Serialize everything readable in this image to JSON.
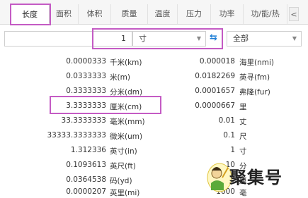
{
  "tabs": [
    "长度",
    "面积",
    "体积",
    "质量",
    "温度",
    "压力",
    "功率",
    "功/能/热"
  ],
  "tab_scroll": "<",
  "input": {
    "value": "1",
    "unit": "寸",
    "filter": "全部",
    "swap_icon": "swap-arrows-icon"
  },
  "left_rows": [
    {
      "value": "0.0000333",
      "unit": "千米(km)"
    },
    {
      "value": "0.0333333",
      "unit": "米(m)"
    },
    {
      "value": "0.3333333",
      "unit": "分米(dm)"
    },
    {
      "value": "3.3333333",
      "unit": "厘米(cm)"
    },
    {
      "value": "33.3333333",
      "unit": "毫米(mm)"
    },
    {
      "value": "33333.3333333",
      "unit": "微米(um)"
    },
    {
      "value": "1.312336",
      "unit": "英寸(in)"
    },
    {
      "value": "0.1093613",
      "unit": "英尺(ft)"
    },
    {
      "value": "0.0364538",
      "unit": "码(yd)"
    },
    {
      "value": "0.0000207",
      "unit": "英里(mi)"
    }
  ],
  "right_rows": [
    {
      "value": "0.000018",
      "unit": "海里(nmi)"
    },
    {
      "value": "0.0182269",
      "unit": "英寻(fm)"
    },
    {
      "value": "0.0001657",
      "unit": "弗隆(fur)"
    },
    {
      "value": "0.0000667",
      "unit": "里"
    },
    {
      "value": "0.01",
      "unit": "丈"
    },
    {
      "value": "0.1",
      "unit": "尺"
    },
    {
      "value": "1",
      "unit": "寸"
    },
    {
      "value": "10",
      "unit": "分"
    },
    {
      "value": "100",
      "unit": "厘"
    },
    {
      "value": "1000",
      "unit": "毫"
    }
  ],
  "watermark": {
    "text": "聚集号"
  },
  "colors": {
    "highlight": "#c45bc4",
    "accent": "#1e7fd6"
  }
}
